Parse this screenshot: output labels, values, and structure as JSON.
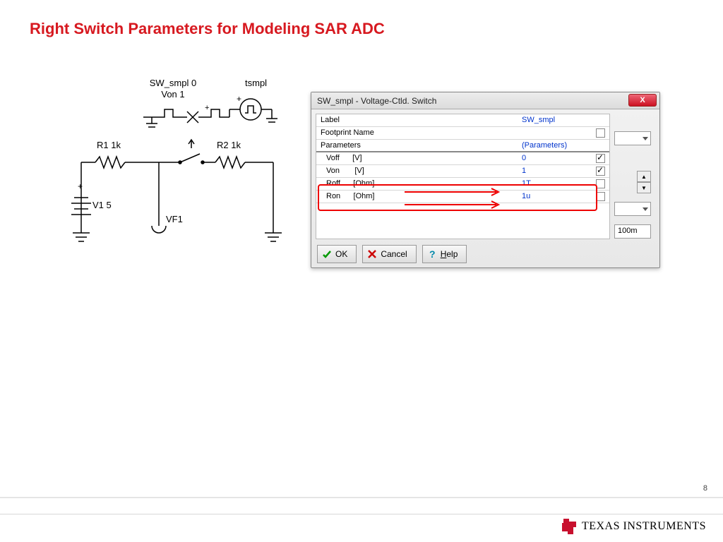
{
  "title": "Right Switch Parameters for Modeling SAR ADC",
  "page_number": "8",
  "brand": "TEXAS INSTRUMENTS",
  "circuit": {
    "sw_label": "SW_smpl 0",
    "von_label": "Von 1",
    "tsmpl": "tsmpl",
    "r1": "R1 1k",
    "r2": "R2 1k",
    "v1": "V1 5",
    "vf1": "VF1",
    "plus": "+"
  },
  "dialog": {
    "title": "SW_smpl - Voltage-Ctld. Switch",
    "close": "X",
    "rows": [
      {
        "label": "Label",
        "value": "SW_smpl",
        "checkbox": "none"
      },
      {
        "label": "Footprint Name",
        "value": "",
        "checkbox": "unchecked"
      },
      {
        "label": "Parameters",
        "value": "(Parameters)",
        "checkbox": "none"
      },
      {
        "label": "Voff      [V]",
        "value": "0",
        "checkbox": "checked"
      },
      {
        "label": "Von       [V]",
        "value": "1",
        "checkbox": "checked"
      },
      {
        "label": "Roff      [Ohm]",
        "value": "1T",
        "checkbox": "unchecked"
      },
      {
        "label": "Ron      [Ohm]",
        "value": "1u",
        "checkbox": "unchecked"
      }
    ],
    "numeric_box": "100m",
    "ok": "OK",
    "cancel": "Cancel",
    "help": "Help"
  }
}
